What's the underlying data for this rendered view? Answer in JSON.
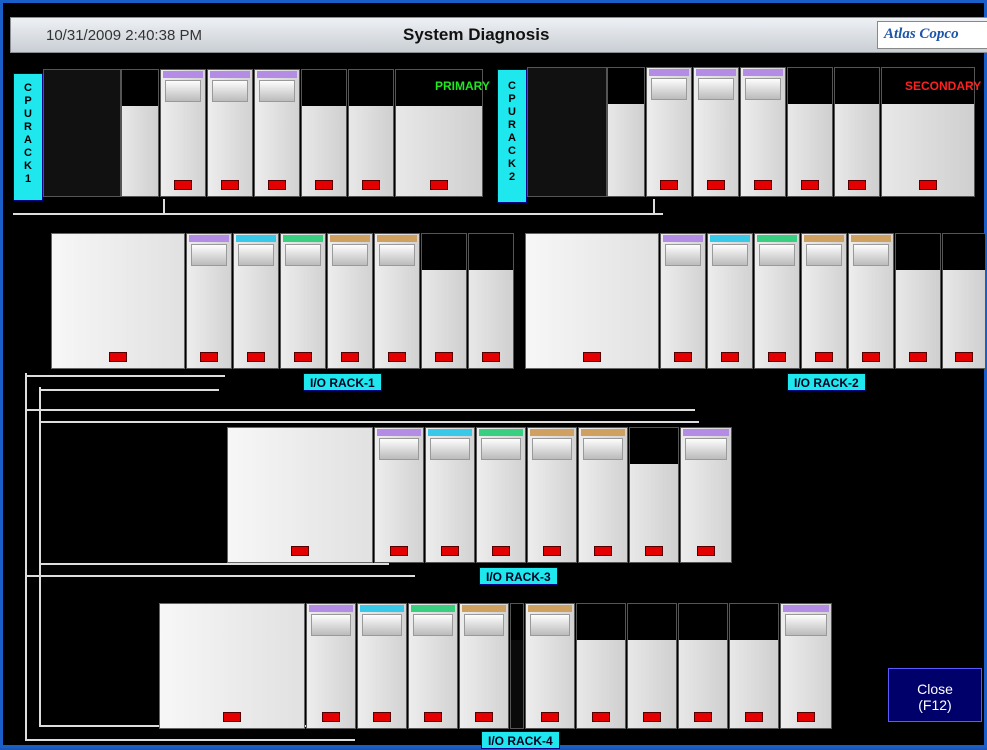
{
  "header": {
    "datetime": "10/31/2009 2:40:38 PM",
    "title": "System Diagnosis",
    "logo_text": "Atlas Copco"
  },
  "cpu_racks": [
    {
      "tag_letters": [
        "C",
        "P",
        "U",
        "R",
        "A",
        "C",
        "K",
        "1"
      ],
      "role": "PRIMARY",
      "role_color": "#1ee81e"
    },
    {
      "tag_letters": [
        "C",
        "P",
        "U",
        "R",
        "A",
        "C",
        "K",
        "2"
      ],
      "role": "SECONDARY",
      "role_color": "#ff2020"
    }
  ],
  "io_racks": [
    {
      "label": "I/O RACK-1"
    },
    {
      "label": "I/O RACK-2"
    },
    {
      "label": "I/O RACK-3"
    },
    {
      "label": "I/O RACK-4"
    }
  ],
  "close_button": {
    "line1": "Close",
    "line2": "(F12)"
  },
  "colors": {
    "tag_cyan": "#1ee8ee",
    "fault_led": "#e40000",
    "close_bg": "#00006b"
  }
}
